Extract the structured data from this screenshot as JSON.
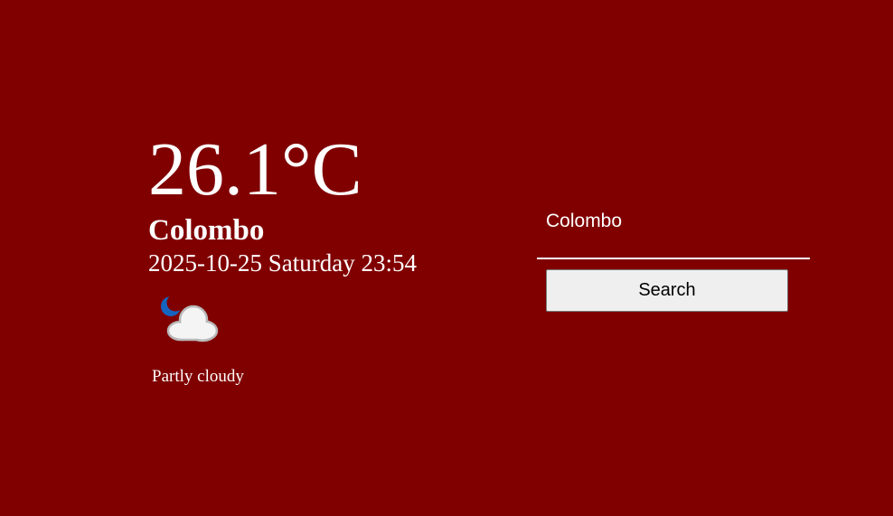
{
  "weather": {
    "temperature": "26.1°C",
    "city": "Colombo",
    "datetime": "2025-10-25 Saturday 23:54",
    "condition_icon": "partly-cloudy-night-icon",
    "condition": "Partly cloudy"
  },
  "search": {
    "value": "Colombo",
    "placeholder": "",
    "button_label": "Search"
  },
  "colors": {
    "background": "#800000",
    "text": "#ffffff",
    "button_bg": "#efefef"
  }
}
